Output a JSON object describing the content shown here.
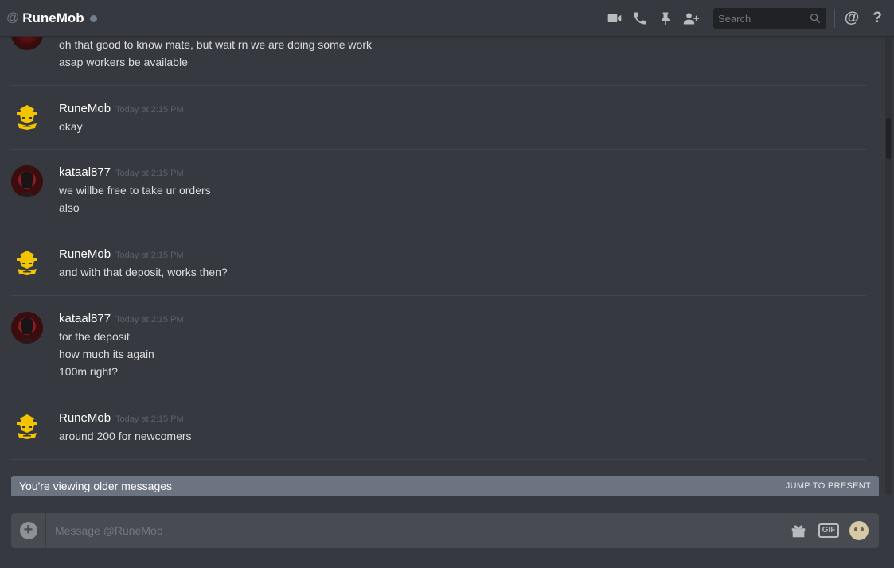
{
  "header": {
    "at_symbol": "@",
    "title": "RuneMob",
    "search_placeholder": "Search",
    "mention_symbol": "@",
    "help_symbol": "?"
  },
  "messages": {
    "top_partial": [
      "oh that good to know mate, but wait rn we are doing some work",
      "asap workers be available"
    ],
    "groups": [
      {
        "author": "RuneMob",
        "timestamp": "Today at 2:15 PM",
        "lines": [
          "okay"
        ]
      },
      {
        "author": "kataal877",
        "timestamp": "Today at 2:15 PM",
        "lines": [
          "we willbe free to take ur orders",
          "also"
        ]
      },
      {
        "author": "RuneMob",
        "timestamp": "Today at 2:15 PM",
        "lines": [
          "and with that deposit, works then?"
        ]
      },
      {
        "author": "kataal877",
        "timestamp": "Today at 2:15 PM",
        "lines": [
          "for the deposit",
          "how much its again",
          "100m right?"
        ]
      },
      {
        "author": "RuneMob",
        "timestamp": "Today at 2:15 PM",
        "lines": [
          "around 200 for newcomers"
        ]
      }
    ]
  },
  "older_bar": {
    "text": "You're viewing older messages",
    "jump_label": "JUMP TO PRESENT"
  },
  "composer": {
    "add_symbol": "+",
    "placeholder": "Message @RuneMob",
    "gif_label": "GIF"
  },
  "colors": {
    "background": "#36393f",
    "header_bg": "#36393f",
    "older_bar_bg": "#6c7481",
    "composer_bg": "#484c52",
    "runemob_avatar": "#f5c400"
  },
  "icons": [
    "video-call-icon",
    "voice-call-icon",
    "pin-icon",
    "add-friend-icon",
    "search-icon",
    "mention-icon",
    "help-icon",
    "add-attachment-icon",
    "gift-icon",
    "gif-icon",
    "emoji-icon"
  ]
}
